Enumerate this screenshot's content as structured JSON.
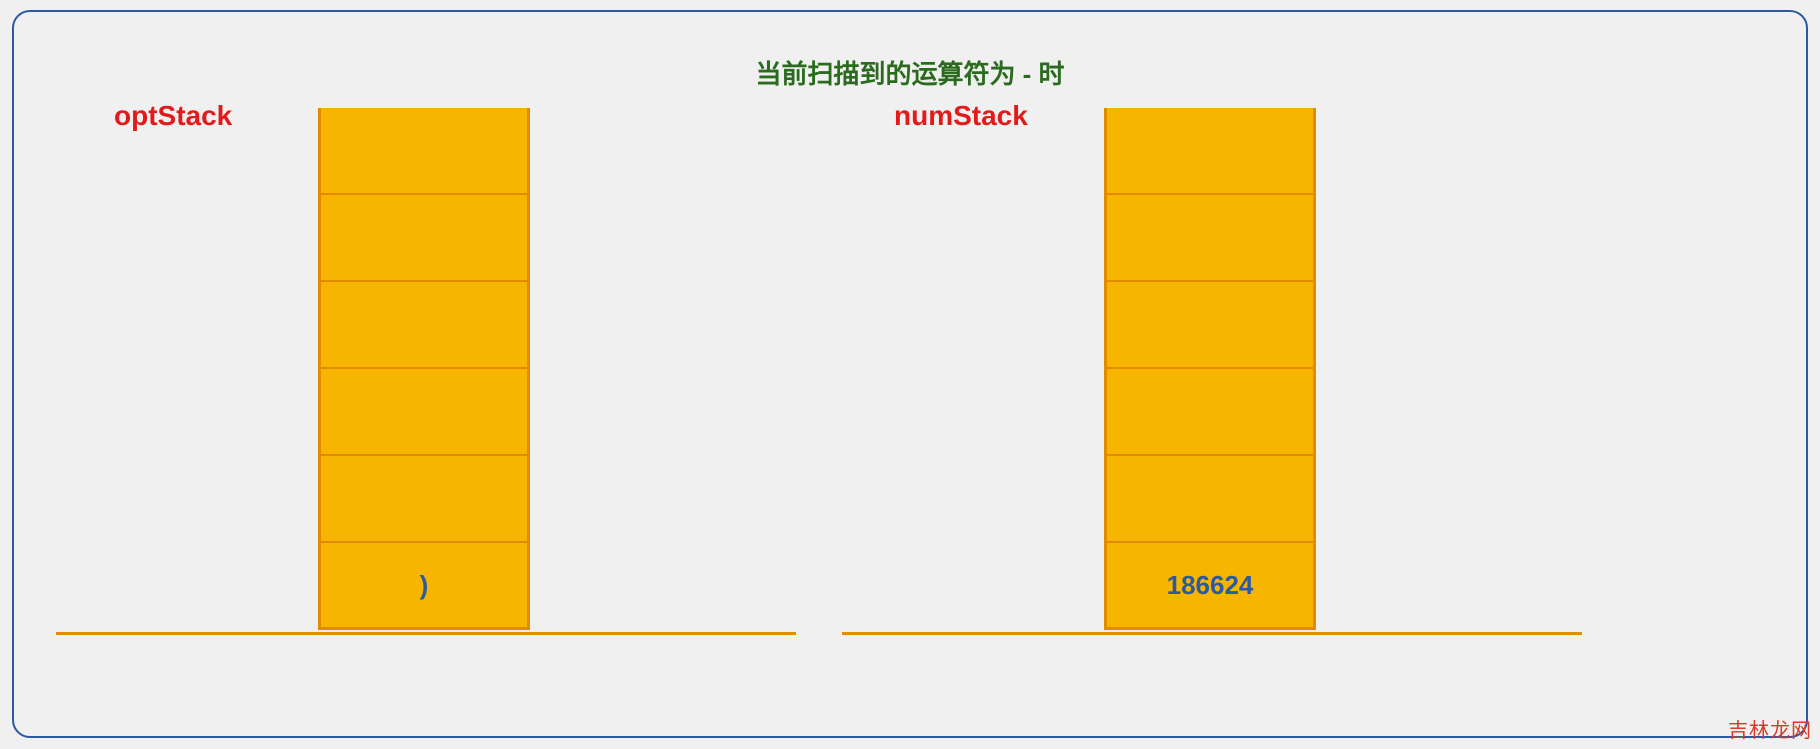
{
  "title": "当前扫描到的运算符为  -  时",
  "optStack": {
    "label": "optStack",
    "cells": [
      "",
      "",
      "",
      "",
      "",
      ")"
    ]
  },
  "numStack": {
    "label": "numStack",
    "cells": [
      "",
      "",
      "",
      "",
      "",
      "186624"
    ]
  },
  "watermark": "吉林龙网",
  "colors": {
    "accent": "#f7b500",
    "border": "#e08b00",
    "label": "#e21a1a",
    "title": "#2b6b1f",
    "value": "#2b5aa0"
  }
}
